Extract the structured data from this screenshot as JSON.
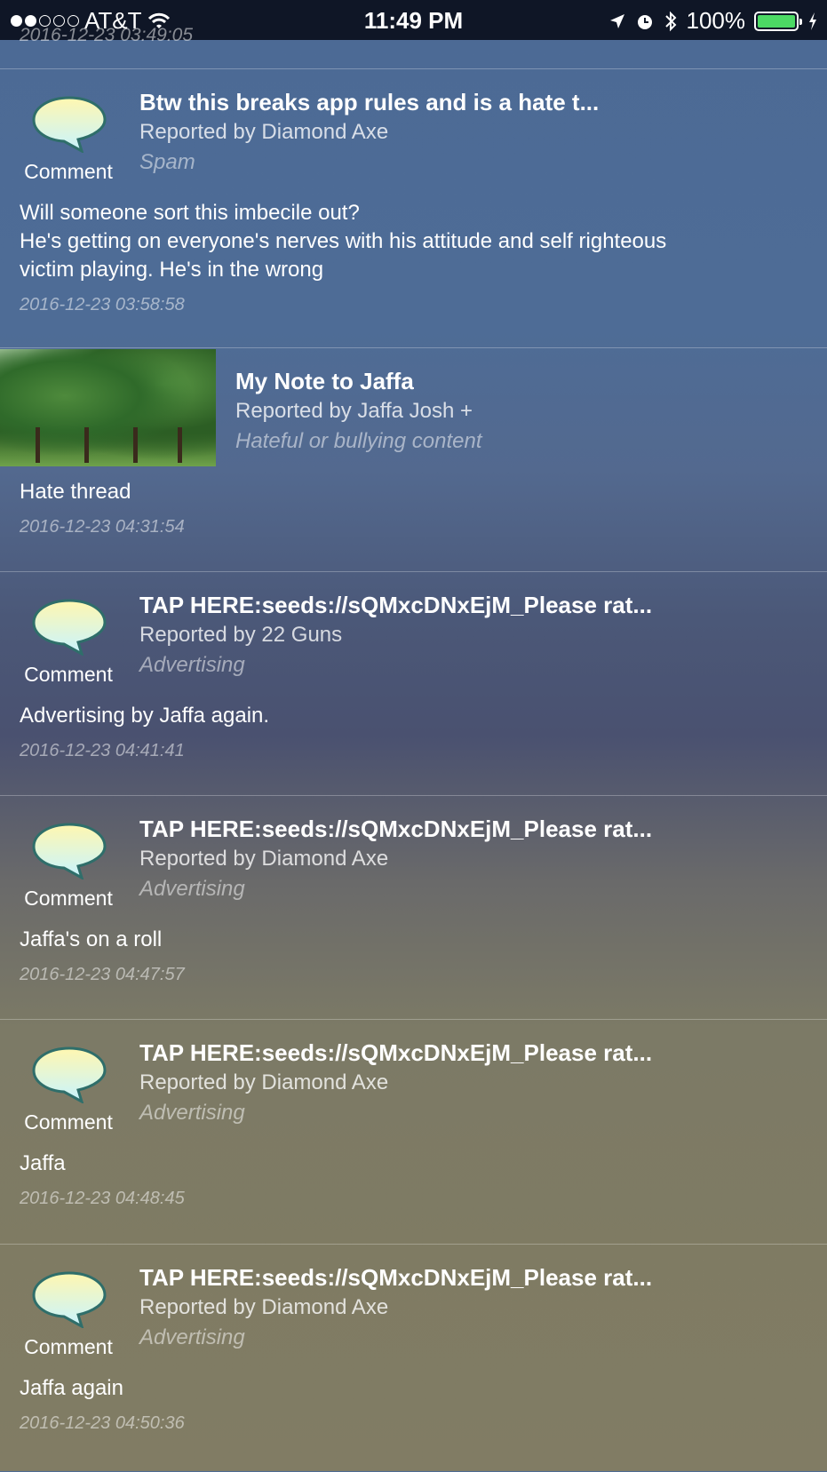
{
  "status_bar": {
    "carrier": "AT&T",
    "time": "11:49 PM",
    "battery": "100%"
  },
  "prev_timestamp": "2016-12-23 03:49:05",
  "reports": [
    {
      "thumb": "comment",
      "thumb_label": "Comment",
      "title": "Btw this breaks app rules and is a hate t...",
      "reporter": "Reported by Diamond Axe",
      "category": "Spam",
      "body": [
        "Will someone sort this imbecile out?",
        "He's getting on everyone's nerves with his attitude and self righteous",
        "victim playing. He's in the wrong"
      ],
      "timestamp": "2016-12-23 03:58:58"
    },
    {
      "thumb": "photo",
      "title": "My Note to Jaffa",
      "reporter": "Reported by Jaffa Josh +",
      "category": "Hateful or bullying content",
      "body": [
        "Hate thread"
      ],
      "timestamp": "2016-12-23 04:31:54"
    },
    {
      "thumb": "comment",
      "thumb_label": "Comment",
      "title": "TAP HERE:seeds://sQMxcDNxEjM_Please rat...",
      "reporter": "Reported by 22 Guns",
      "category": "Advertising",
      "body": [
        "Advertising by Jaffa again."
      ],
      "timestamp": "2016-12-23 04:41:41"
    },
    {
      "thumb": "comment",
      "thumb_label": "Comment",
      "title": "TAP HERE:seeds://sQMxcDNxEjM_Please rat...",
      "reporter": "Reported by Diamond Axe",
      "category": "Advertising",
      "body": [
        "Jaffa's on a roll"
      ],
      "timestamp": "2016-12-23 04:47:57"
    },
    {
      "thumb": "comment",
      "thumb_label": "Comment",
      "title": "TAP HERE:seeds://sQMxcDNxEjM_Please rat...",
      "reporter": "Reported by Diamond Axe",
      "category": "Advertising",
      "body": [
        "Jaffa"
      ],
      "timestamp": "2016-12-23 04:48:45"
    },
    {
      "thumb": "comment",
      "thumb_label": "Comment",
      "title": "TAP HERE:seeds://sQMxcDNxEjM_Please rat...",
      "reporter": "Reported by Diamond Axe",
      "category": "Advertising",
      "body": [
        "Jaffa again"
      ],
      "timestamp": "2016-12-23 04:50:36"
    }
  ],
  "colors": {
    "status_bar_bg": "#0f1626",
    "battery_fill": "#4cd964"
  }
}
